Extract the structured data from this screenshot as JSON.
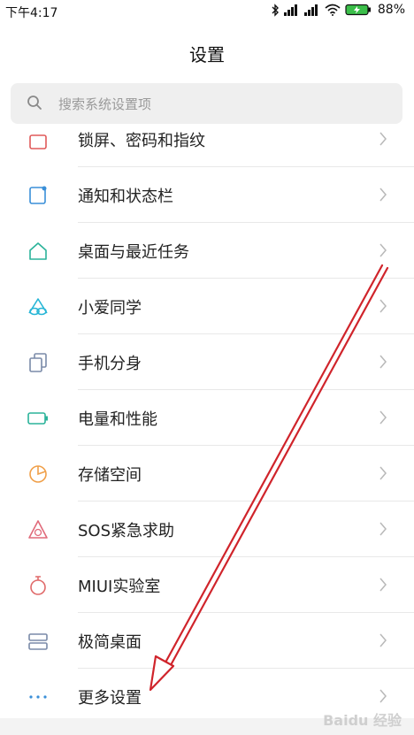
{
  "status_bar": {
    "time": "下午4:17",
    "battery_percent": "88%",
    "icons": [
      "bluetooth-icon",
      "signal-icon",
      "signal-icon",
      "wifi-icon",
      "battery-charging-icon"
    ]
  },
  "header": {
    "title": "设置"
  },
  "search": {
    "placeholder": "搜索系统设置项"
  },
  "settings_items": [
    {
      "label": "锁屏、密码和指纹",
      "icon": "lock-icon",
      "color": "#e05a5a"
    },
    {
      "label": "通知和状态栏",
      "icon": "notification-icon",
      "color": "#3a8fd8"
    },
    {
      "label": "桌面与最近任务",
      "icon": "home-icon",
      "color": "#2bb39a"
    },
    {
      "label": "小爱同学",
      "icon": "xiaoai-icon",
      "color": "#27b6d6"
    },
    {
      "label": "手机分身",
      "icon": "second-space-icon",
      "color": "#7a8aa8"
    },
    {
      "label": "电量和性能",
      "icon": "battery-icon",
      "color": "#2bb39a"
    },
    {
      "label": "存储空间",
      "icon": "storage-icon",
      "color": "#f0a04a"
    },
    {
      "label": "SOS紧急求助",
      "icon": "sos-icon",
      "color": "#e06a7a"
    },
    {
      "label": "MIUI实验室",
      "icon": "lab-icon",
      "color": "#e06a6a"
    },
    {
      "label": "极简桌面",
      "icon": "simple-home-icon",
      "color": "#7a8aa8"
    },
    {
      "label": "更多设置",
      "icon": "more-icon",
      "color": "#3a8fd8"
    }
  ],
  "watermark": "Baidu 经验",
  "annotation": {
    "arrow_color": "#d0242b"
  }
}
